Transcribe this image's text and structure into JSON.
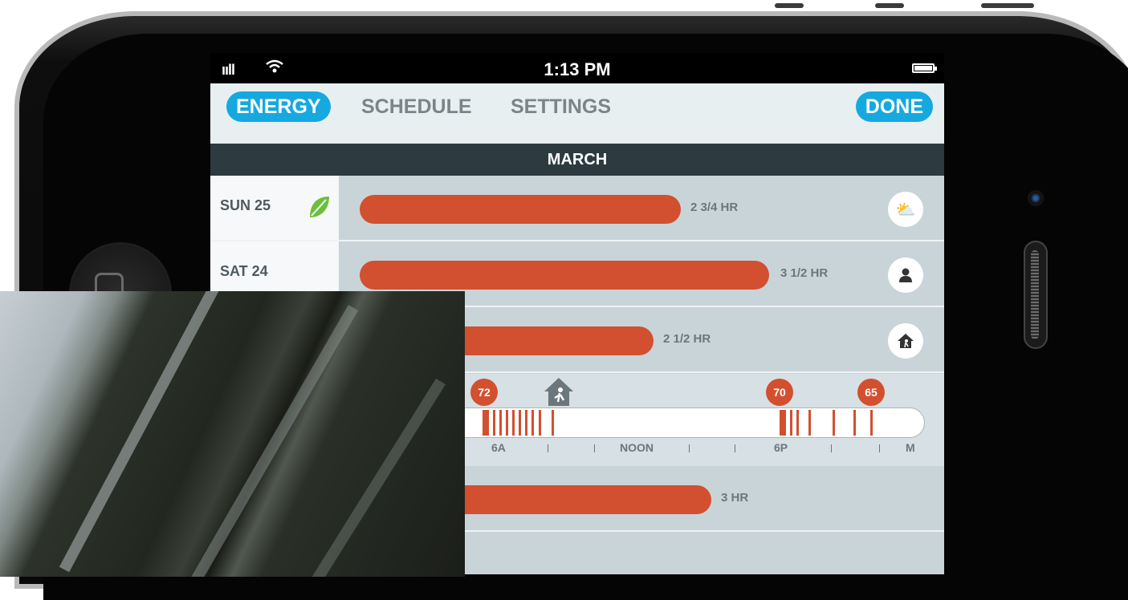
{
  "status_bar": {
    "time": "1:13 PM"
  },
  "nav": {
    "tabs": [
      "ENERGY",
      "SCHEDULE",
      "SETTINGS"
    ],
    "active_tab": "ENERGY",
    "done_label": "DONE"
  },
  "month": "MARCH",
  "days": [
    {
      "label": "SUN  25",
      "hours": "2 3/4 HR",
      "leaf": true,
      "mode_icon": "weather-icon"
    },
    {
      "label": "SAT  24",
      "hours": "3 1/2 HR",
      "leaf": false,
      "mode_icon": "person-icon"
    },
    {
      "hours": "2 1/2 HR",
      "mode_icon": "away-home-icon"
    },
    {
      "hours": "3 HR"
    }
  ],
  "timeline": {
    "labels": [
      "6A",
      "NOON",
      "6P",
      "M"
    ],
    "temps": [
      "72",
      "70",
      "65"
    ]
  },
  "colors": {
    "accent": "#15a9df",
    "bar": "#d2502f",
    "header_dark": "#2d3a40",
    "leaf": "#6bbf3a"
  }
}
